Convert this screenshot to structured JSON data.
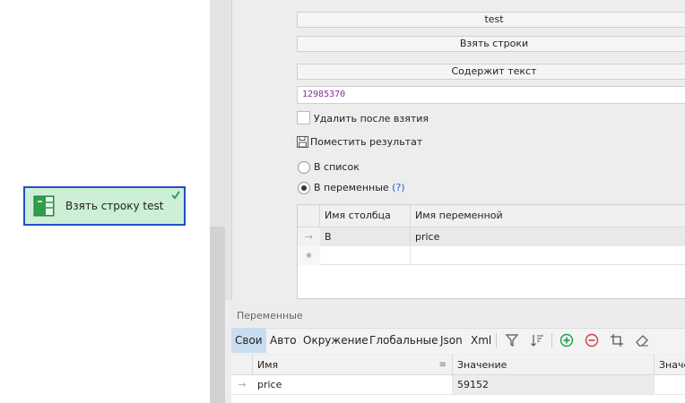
{
  "canvas": {
    "action_block": {
      "label": "Взять строку test",
      "status": "done"
    }
  },
  "properties": {
    "table_name": "test",
    "operation": "Взять строки",
    "filter_mode": "Содержит текст",
    "search_value": "12985370",
    "delete_after_take_label": "Удалить после взятия",
    "delete_after_take_checked": false,
    "save_result_label": "Поместить результат",
    "radio_to_list": "В список",
    "radio_to_variables": "В переменные",
    "help_link": "(?)",
    "selected_target": "variables",
    "mapping": {
      "columns": [
        "Имя столбца",
        "Имя переменной"
      ],
      "rows": [
        {
          "column": "B",
          "variable": "price"
        }
      ]
    }
  },
  "variables_panel": {
    "title": "Переменные",
    "tabs": [
      "Свои",
      "Авто",
      "Окружение",
      "Глобальные",
      "Json",
      "Xml"
    ],
    "active_tab": "Свои",
    "columns": [
      "Имя",
      "Значение",
      "Значе"
    ],
    "rows": [
      {
        "name": "price",
        "value": "59152"
      }
    ]
  },
  "colors": {
    "block_fill": "#ccefd5",
    "block_border": "#1f4fc6",
    "value_text": "#8b2f9b",
    "add_icon": "#1a9e4a",
    "remove_icon": "#d43c3c",
    "active_tab": "#c9ddf0"
  }
}
